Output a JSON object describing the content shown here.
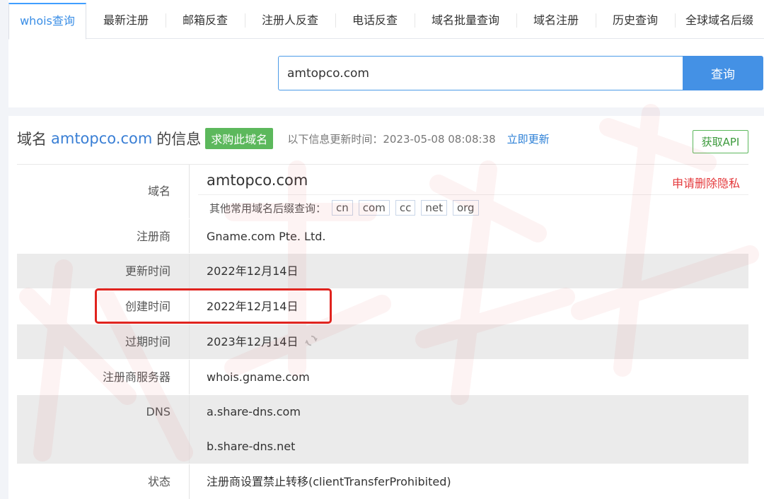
{
  "tabs": [
    {
      "label": "whois查询",
      "active": true
    },
    {
      "label": "最新注册"
    },
    {
      "label": "邮箱反查"
    },
    {
      "label": "注册人反查"
    },
    {
      "label": "电话反查"
    },
    {
      "label": "域名批量查询"
    },
    {
      "label": "域名注册"
    },
    {
      "label": "历史查询"
    },
    {
      "label": "全球域名后缀"
    }
  ],
  "search": {
    "value": "amtopco.com",
    "button_label": "查询"
  },
  "header": {
    "title_prefix": "域名",
    "domain": "amtopco.com",
    "title_suffix": "的信息",
    "buy_badge": "求购此域名",
    "updated_label": "以下信息更新时间：2023-05-08 08:08:38",
    "update_link": "立即更新",
    "api_button": "获取API"
  },
  "domain_row": {
    "label": "域名",
    "domain": "amtopco.com",
    "privacy_link": "申请删除隐私",
    "suffix_label": "其他常用域名后缀查询：",
    "suffixes": [
      "cn",
      "com",
      "cc",
      "net",
      "org"
    ]
  },
  "rows": {
    "registrar": {
      "label": "注册商",
      "value": "Gname.com Pte. Ltd."
    },
    "updated": {
      "label": "更新时间",
      "value": "2022年12月14日"
    },
    "created": {
      "label": "创建时间",
      "value": "2022年12月14日"
    },
    "expires": {
      "label": "过期时间",
      "value": "2023年12月14日"
    },
    "whois_server": {
      "label": "注册商服务器",
      "value": "whois.gname.com"
    },
    "dns": {
      "label": "DNS",
      "values": [
        "a.share-dns.com",
        "b.share-dns.net"
      ]
    },
    "status": {
      "label": "状态",
      "value": "注册商设置禁止转移(clientTransferProhibited)"
    }
  },
  "colors": {
    "accent": "#4491e5",
    "link": "#3a7fd5",
    "buy_green": "#5cb85c",
    "privacy_red": "#e4393c",
    "highlight_red": "#e0231e"
  },
  "icons": {
    "refresh": "refresh-icon"
  }
}
